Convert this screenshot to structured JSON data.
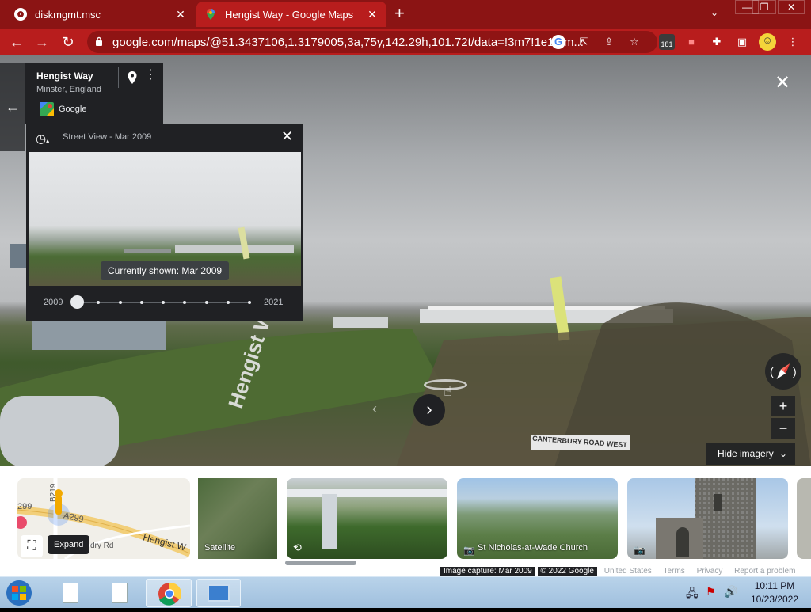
{
  "tabs": [
    {
      "title": "diskmgmt.msc",
      "close": "✕",
      "active": false
    },
    {
      "title": "Hengist Way - Google Maps",
      "close": "✕",
      "active": true
    }
  ],
  "browser": {
    "new_tab": "+",
    "tab_search": "⌄",
    "window_controls": [
      "—",
      "❐",
      "✕"
    ],
    "url": "google.com/maps/@51.3437106,1.3179005,3a,75y,142.29h,101.72t/data=!3m7!1e1!3m...",
    "extension_badge": "181",
    "colors": {
      "tabbar": "#8b1414",
      "toolbar": "#b81d1d",
      "omnibox": "#8f1414"
    }
  },
  "place": {
    "title": "Hengist Way",
    "subtitle": "Minster, England",
    "provider": "Google"
  },
  "timeline": {
    "header": "Street View - Mar 2009",
    "tooltip": "Currently shown: Mar 2009",
    "start_year": "2009",
    "end_year": "2021",
    "selected_index": 0,
    "stops": 9
  },
  "street": {
    "road_marking": "Hengist Way",
    "sign": "CANTERBURY ROAD WEST",
    "hide_imagery": "Hide imagery",
    "zoom_in": "+",
    "zoom_out": "−"
  },
  "strip": {
    "map_labels": {
      "road": "Hengist W",
      "b219": "B219",
      "a299": "A299",
      "small": "dry Rd",
      "left": "299"
    },
    "expand_tooltip": "Expand",
    "cards": [
      {
        "label": "Satellite"
      },
      {
        "label": ""
      },
      {
        "label": "St Nicholas-at-Wade Church"
      },
      {
        "label": ""
      }
    ],
    "attribution": [
      "Image capture: Mar 2009",
      "© 2022 Google",
      "United States",
      "Terms",
      "Privacy",
      "Report a problem"
    ]
  },
  "taskbar": {
    "time": "10:11 PM",
    "date": "10/23/2022"
  }
}
